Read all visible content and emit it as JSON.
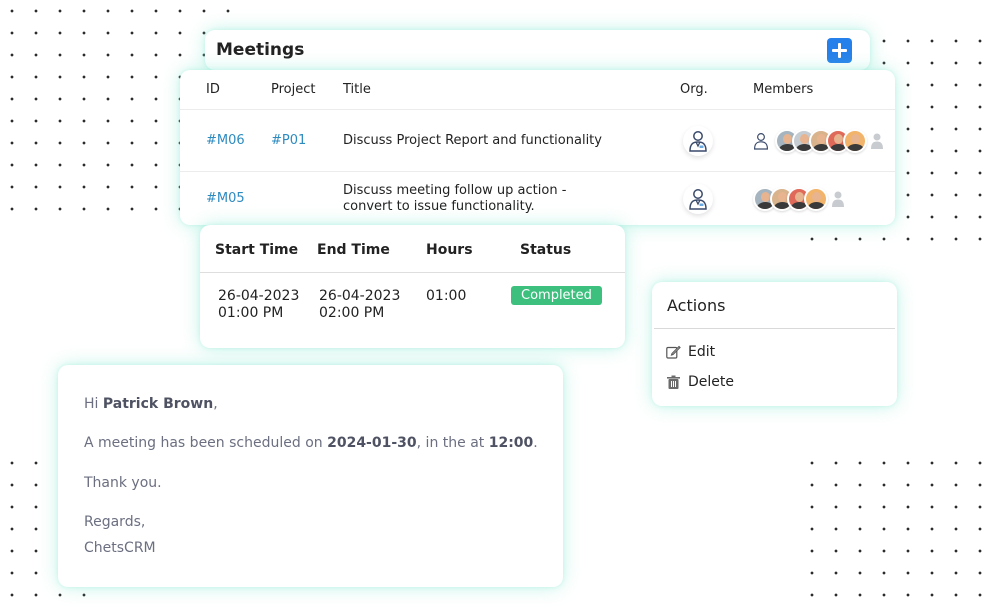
{
  "meetings": {
    "title": "Meetings",
    "add_icon": "plus-square-icon",
    "columns": {
      "id": "ID",
      "project": "Project",
      "title": "Title",
      "org": "Org.",
      "members": "Members"
    },
    "rows": [
      {
        "id": "#M06",
        "project": "#P01",
        "title_line1": "Discuss Project Report and functionality",
        "title_line2": ""
      },
      {
        "id": "#M05",
        "project": "",
        "title_line1": "Discuss meeting follow up action -",
        "title_line2": "convert to issue functionality."
      }
    ]
  },
  "timing": {
    "columns": {
      "start": "Start Time",
      "end": "End Time",
      "hours": "Hours",
      "status": "Status"
    },
    "row": {
      "start_date": "26-04-2023",
      "start_time": "01:00 PM",
      "end_date": "26-04-2023",
      "end_time": "02:00 PM",
      "hours": "01:00",
      "status": "Completed"
    },
    "status_color": "#3dbf7e"
  },
  "actions": {
    "title": "Actions",
    "items": [
      {
        "label": "Edit",
        "icon": "edit-icon"
      },
      {
        "label": "Delete",
        "icon": "trash-icon"
      }
    ]
  },
  "email": {
    "greeting_prefix": "Hi ",
    "recipient": "Patrick Brown",
    "greeting_suffix": ",",
    "body_prefix": "A meeting has been scheduled on ",
    "date": "2024-01-30",
    "body_middle": ", in the at ",
    "time": "12:00",
    "body_suffix": ".",
    "thanks": "Thank you.",
    "regards": "Regards,",
    "signature": "ChetsCRM"
  },
  "colors": {
    "accent": "#2680eb",
    "link": "#2e8bc0",
    "success": "#3dbf7e",
    "glow": "#78e6cd"
  }
}
